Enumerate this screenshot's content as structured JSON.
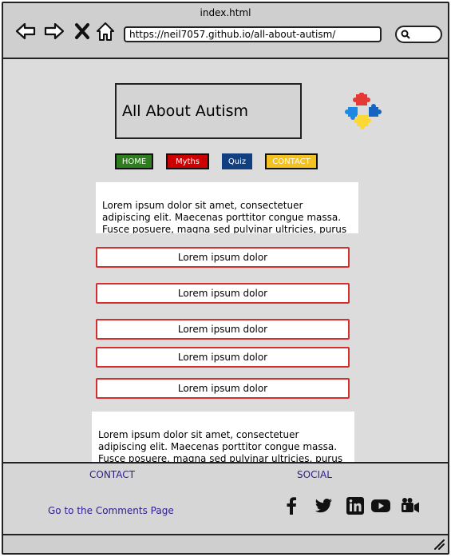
{
  "window": {
    "title": "index.html"
  },
  "browser": {
    "url": "https://neil7057.github.io/all-about-autism/",
    "icons": [
      "back-arrow-icon",
      "forward-arrow-icon",
      "close-x-icon",
      "home-icon",
      "search-icon"
    ]
  },
  "header": {
    "title": "All About Autism",
    "logo_icon": "puzzle-pieces-icon"
  },
  "nav": {
    "home": "HOME",
    "myths": "Myths",
    "quiz": "Quiz",
    "contact": "CONTACT",
    "colors": {
      "home": "#2e7d1f",
      "myths": "#cc0000",
      "quiz": "#123f80",
      "contact": "#f4c21f"
    }
  },
  "main": {
    "intro_text": "Lorem ipsum dolor sit amet, consectetuer adipiscing elit. Maecenas porttitor congue massa. Fusce posuere, magna sed pulvinar ultricies, purus lectus",
    "items": [
      "Lorem ipsum dolor",
      "Lorem ipsum dolor",
      "Lorem ipsum dolor",
      "Lorem ipsum dolor",
      "Lorem ipsum dolor"
    ],
    "outro_text": "Lorem ipsum dolor sit amet, consectetuer adipiscing elit. Maecenas porttitor congue massa. Fusce posuere, magna sed pulvinar ultricies, purus lectus"
  },
  "footer": {
    "contact_heading": "CONTACT",
    "social_heading": "SOCIAL",
    "comments_link": "Go to the Comments Page",
    "social_icons": [
      "facebook-icon",
      "twitter-icon",
      "linkedin-icon",
      "youtube-icon",
      "video-camera-icon"
    ],
    "link_color": "#2b1f8f"
  }
}
